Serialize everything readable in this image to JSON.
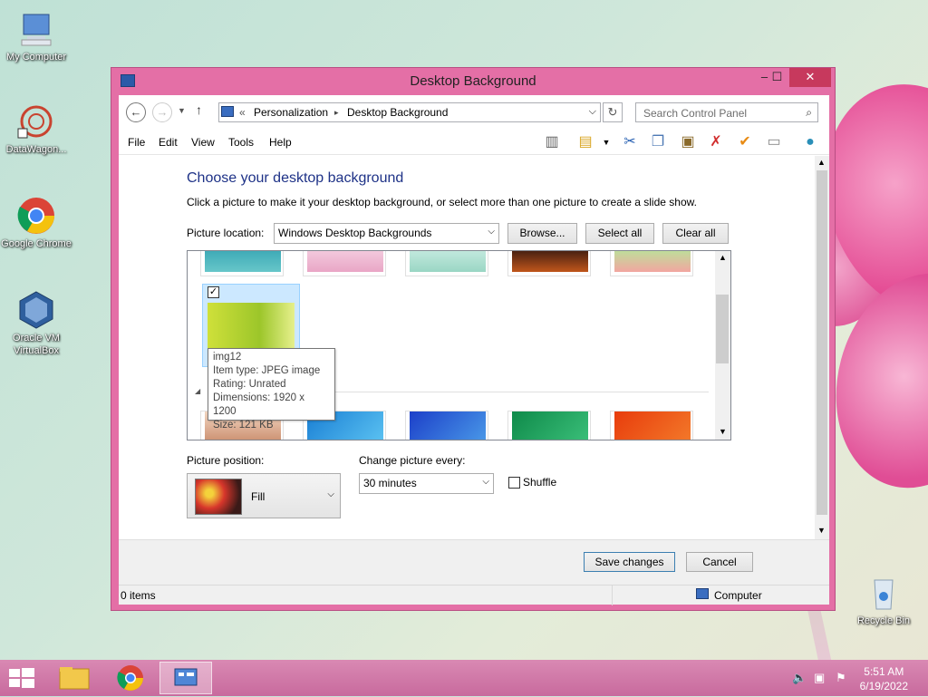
{
  "desktop": {
    "icons": [
      {
        "label": "My Computer"
      },
      {
        "label": "DataWagon..."
      },
      {
        "label": "Google Chrome"
      },
      {
        "label": "Oracle VM VirtualBox"
      },
      {
        "label": "Recycle Bin"
      }
    ]
  },
  "window": {
    "title": "Desktop Background",
    "controls": {
      "minimize": "–",
      "maximize": "☐",
      "close": "✕"
    }
  },
  "address": {
    "back": "←",
    "forward": "→",
    "up": "↑",
    "prefix": "«",
    "crumbs": [
      "Personalization",
      "Desktop Background"
    ],
    "separator": "▸",
    "search_placeholder": "Search Control Panel"
  },
  "menu": {
    "items": [
      "File",
      "Edit",
      "View",
      "Tools",
      "Help"
    ]
  },
  "toolbar": {
    "icons": [
      "layout-icon",
      "folder-check-icon",
      "cut-icon",
      "copy-icon",
      "paste-icon",
      "delete-icon",
      "check-icon",
      "window-icon",
      "globe-icon"
    ]
  },
  "content": {
    "heading": "Choose your desktop background",
    "subtext": "Click a picture to make it your desktop background, or select more than one picture to create a slide show.",
    "picture_location_label": "Picture location:",
    "picture_location_value": "Windows Desktop Backgrounds",
    "browse": "Browse...",
    "select_all": "Select all",
    "clear_all": "Clear all",
    "tooltip": {
      "name": "img12",
      "type": "Item type: JPEG image",
      "rating": "Rating: Unrated",
      "dimensions": "Dimensions: 1920 x 1200",
      "size": "Size: 121 KB"
    },
    "picture_position_label": "Picture position:",
    "picture_position_value": "Fill",
    "change_every_label": "Change picture every:",
    "change_every_value": "30 minutes",
    "shuffle_label": "Shuffle"
  },
  "buttons": {
    "save": "Save changes",
    "cancel": "Cancel"
  },
  "status": {
    "items": "0 items",
    "location": "Computer"
  },
  "taskbar": {
    "time": "5:51 AM",
    "date": "6/19/2022"
  },
  "colors": {
    "accent": "#e46fa6",
    "heading": "#1e3287",
    "close": "#c7395d"
  }
}
